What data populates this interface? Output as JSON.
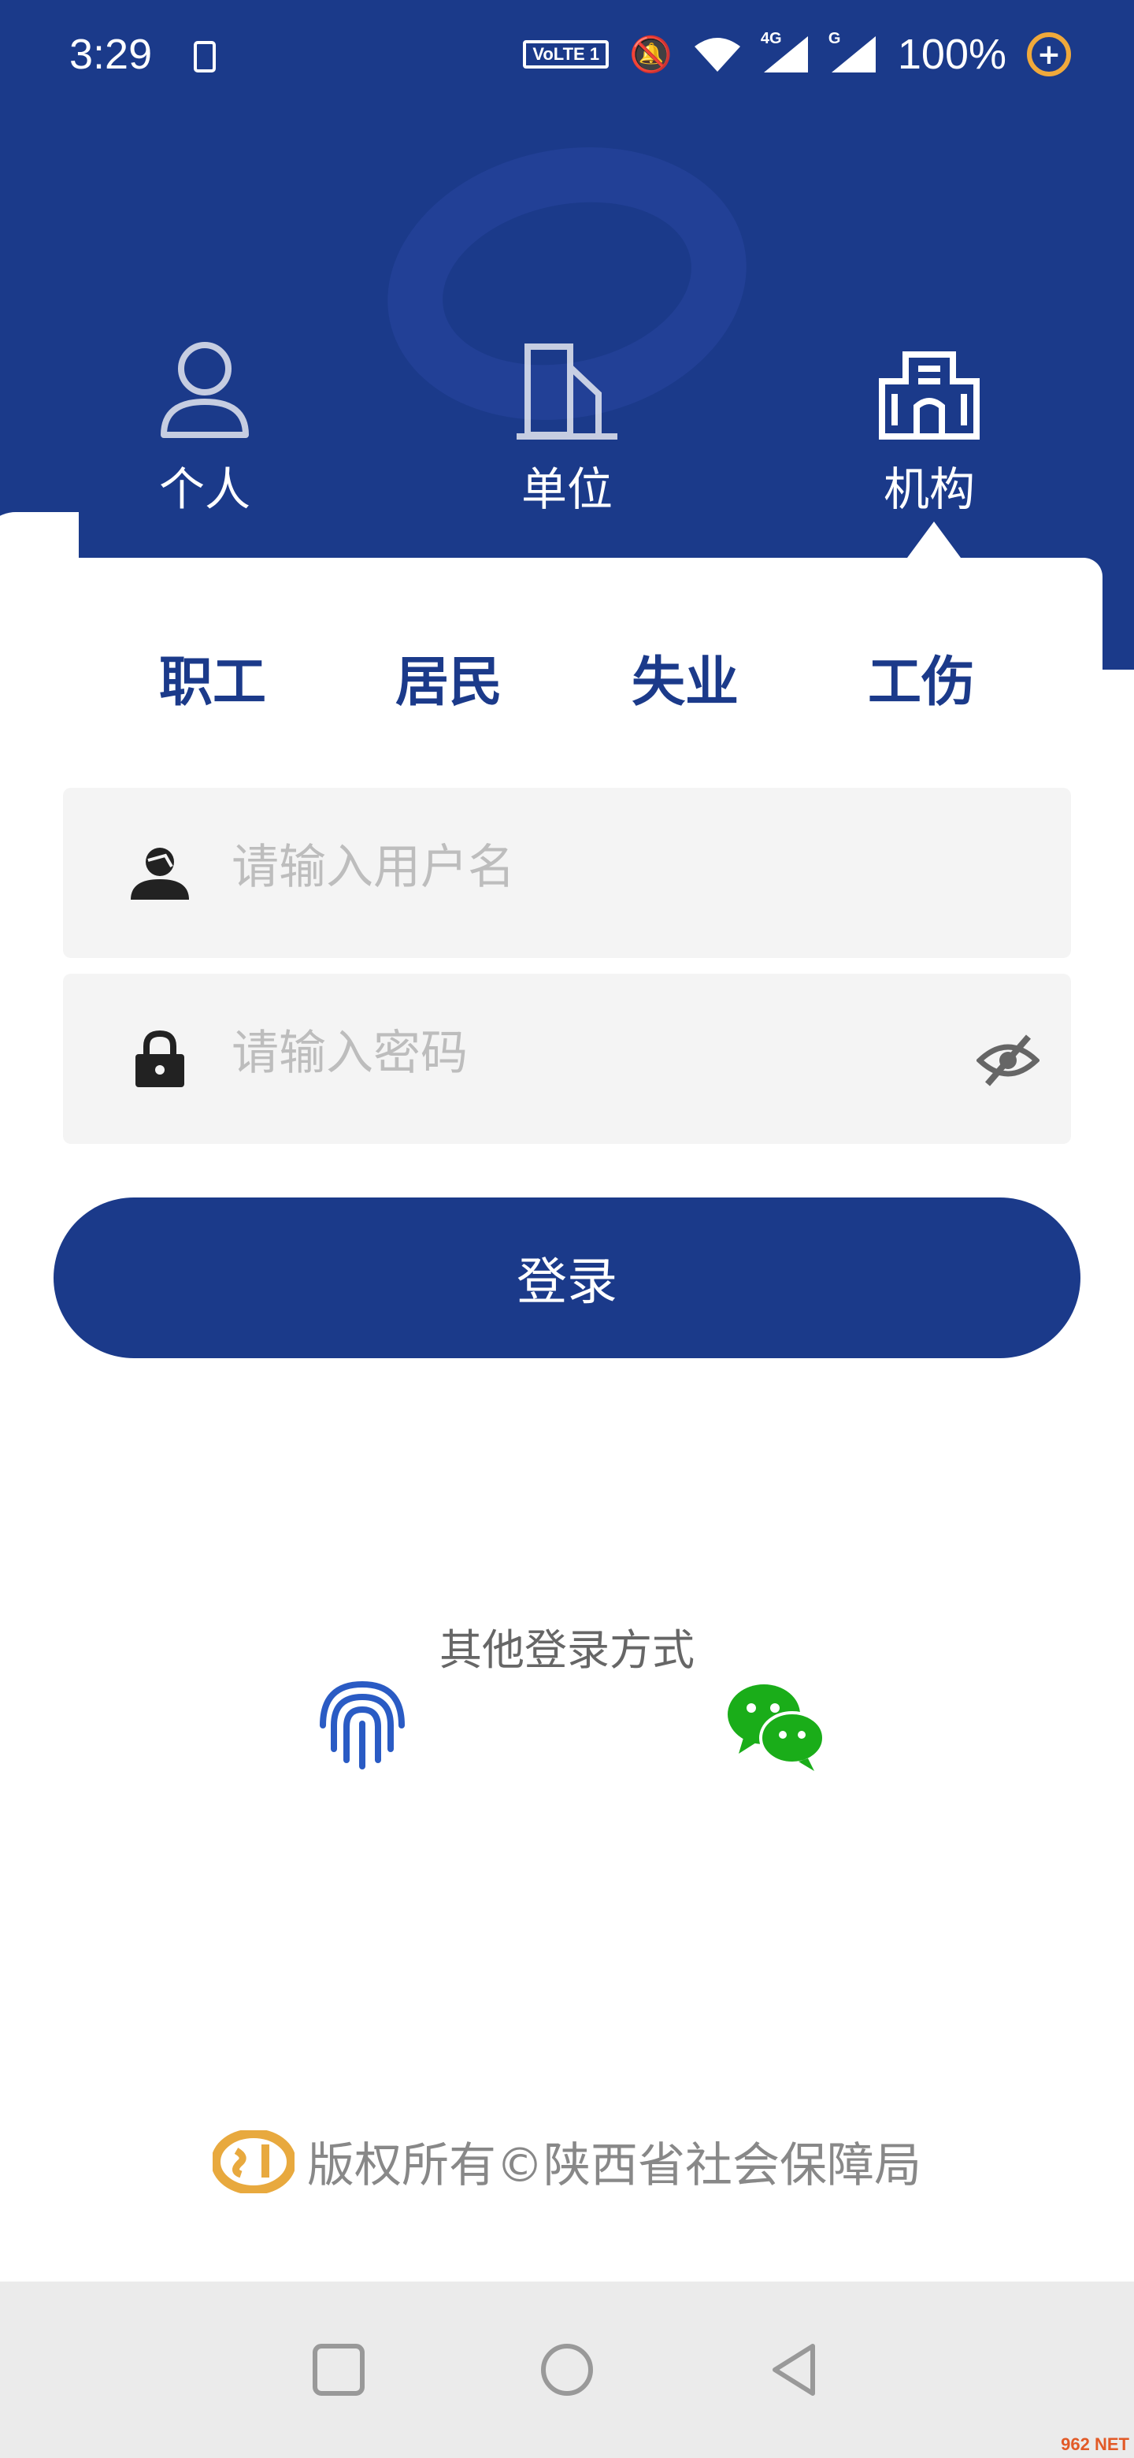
{
  "status_bar": {
    "time": "3:29",
    "volte_label": "VoLTE 1",
    "signal_1_label": "4G",
    "signal_2_label": "G",
    "battery": "100%"
  },
  "user_types": [
    {
      "label": "个人",
      "icon": "person-icon",
      "selected": false
    },
    {
      "label": "单位",
      "icon": "building-icon",
      "selected": false
    },
    {
      "label": "机构",
      "icon": "institution-icon",
      "selected": true
    }
  ],
  "sub_tabs": [
    "职工",
    "居民",
    "失业",
    "工伤"
  ],
  "form": {
    "username_placeholder": "请输入用户名",
    "password_placeholder": "请输入密码",
    "login_label": "登录"
  },
  "other_login": {
    "title": "其他登录方式",
    "methods": [
      "fingerprint-icon",
      "wechat-icon"
    ]
  },
  "footer": {
    "copyright": "版权所有©陕西省社会保障局"
  },
  "colors": {
    "primary": "#1b3a8a",
    "wechat": "#1aad19",
    "fingerprint": "#2a5bc4",
    "logo_gold": "#e8a93e"
  },
  "watermark_badge": "962 NET"
}
